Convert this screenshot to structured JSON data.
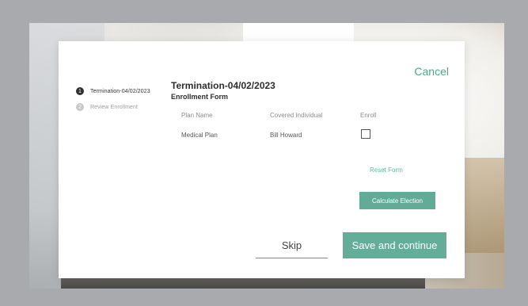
{
  "header": {
    "cancel_label": "Cancel"
  },
  "steps": [
    {
      "number": "1",
      "label": "Termination-04/02/2023",
      "state": "active"
    },
    {
      "number": "2",
      "label": "Review Enrollment",
      "state": "inactive"
    }
  ],
  "form": {
    "title": "Termination-04/02/2023",
    "subtitle": "Enrollment Form",
    "columns": [
      "Plan Name",
      "Covered Individual",
      "Enroll"
    ],
    "rows": [
      {
        "plan": "Medical Plan",
        "individual": "Bill Howard",
        "enroll_checked": false
      }
    ],
    "reset_label": "Reset Form",
    "calculate_label": "Calculate Election"
  },
  "footer": {
    "skip_label": "Skip",
    "save_label": "Save and continue"
  },
  "colors": {
    "accent": "#64ad98",
    "link": "#4aa98c"
  }
}
